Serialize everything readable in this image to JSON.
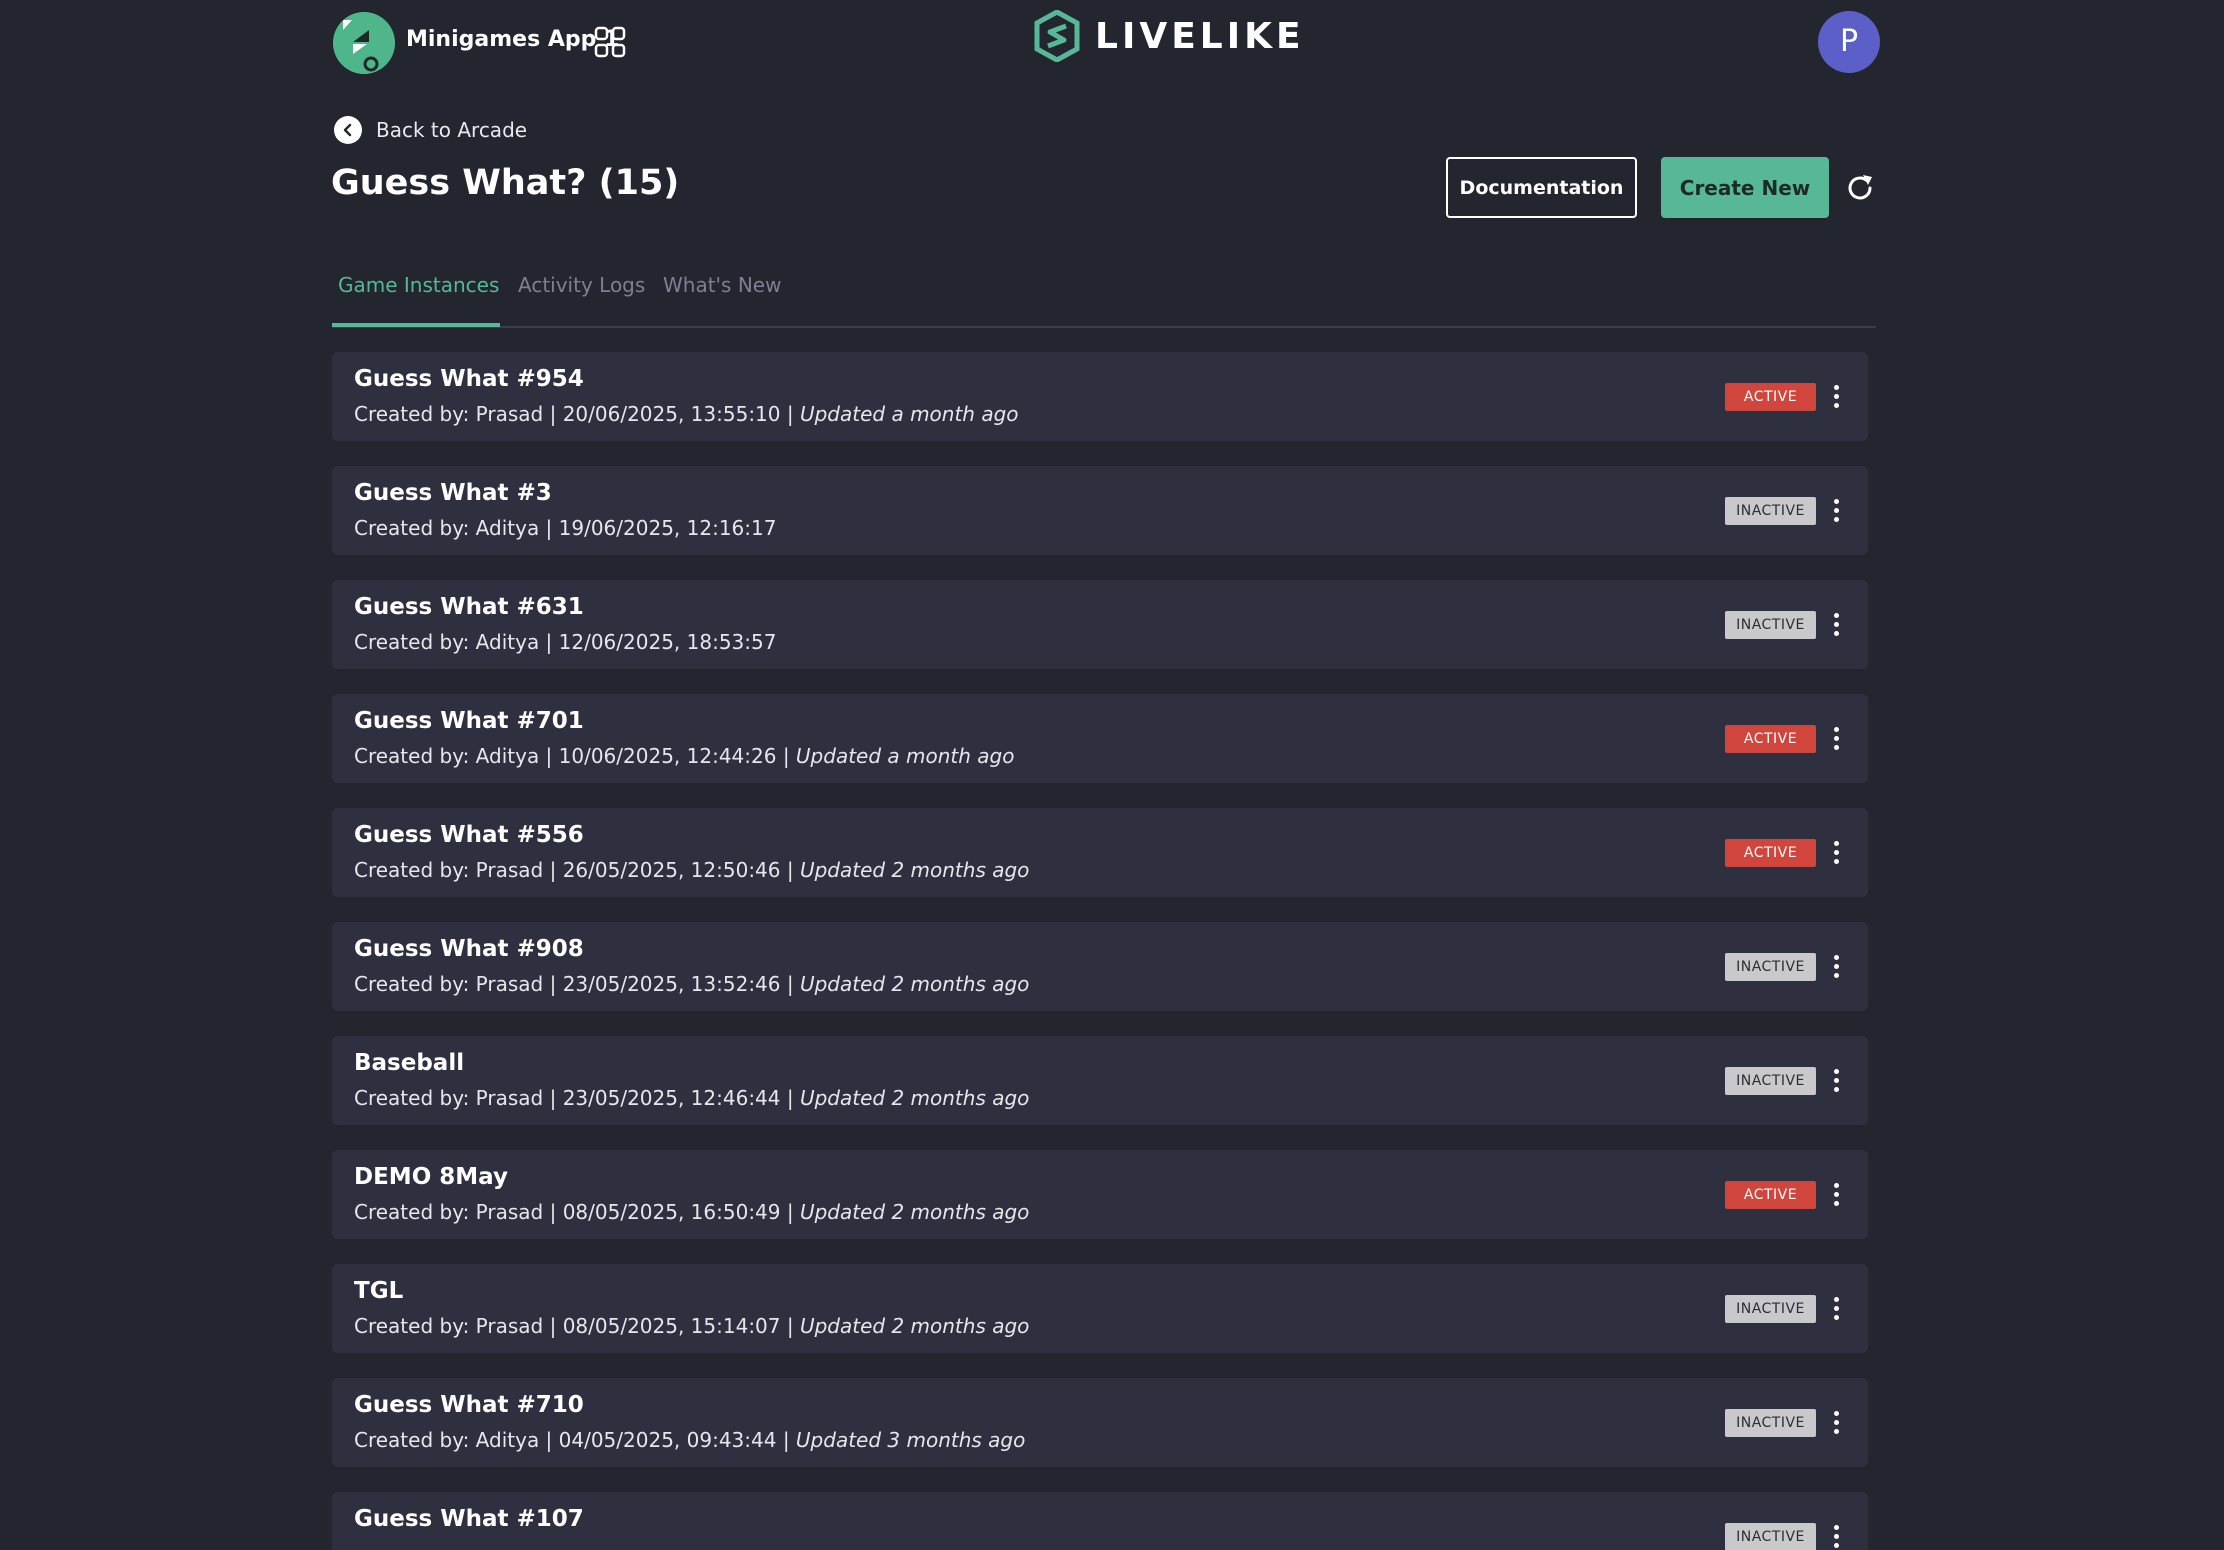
{
  "header": {
    "app_name": "Minigames App 1",
    "brand": "LIVELIKE",
    "avatar_initial": "P"
  },
  "nav": {
    "back_label": "Back to Arcade"
  },
  "page": {
    "title": "Guess What? (15)",
    "documentation_label": "Documentation",
    "create_label": "Create New"
  },
  "tabs": [
    {
      "label": "Game Instances",
      "active": true
    },
    {
      "label": "Activity Logs",
      "active": false
    },
    {
      "label": "What's New",
      "active": false
    }
  ],
  "colors": {
    "accent": "#56b896",
    "background": "#23252f",
    "card": "#2e3040",
    "active_badge": "#d0463d",
    "inactive_badge": "#c9c9cc"
  },
  "instances": [
    {
      "title": "Guess What #954",
      "meta": "Created by: Prasad | 20/06/2025, 13:55:10 | ",
      "updated": "Updated a month ago",
      "status": "ACTIVE"
    },
    {
      "title": "Guess What #3",
      "meta": "Created by: Aditya | 19/06/2025, 12:16:17",
      "updated": "",
      "status": "INACTIVE"
    },
    {
      "title": "Guess What #631",
      "meta": "Created by: Aditya | 12/06/2025, 18:53:57",
      "updated": "",
      "status": "INACTIVE"
    },
    {
      "title": "Guess What #701",
      "meta": "Created by: Aditya | 10/06/2025, 12:44:26 | ",
      "updated": "Updated a month ago",
      "status": "ACTIVE"
    },
    {
      "title": "Guess What #556",
      "meta": "Created by: Prasad | 26/05/2025, 12:50:46 | ",
      "updated": "Updated 2 months ago",
      "status": "ACTIVE"
    },
    {
      "title": "Guess What #908",
      "meta": "Created by: Prasad | 23/05/2025, 13:52:46 | ",
      "updated": "Updated 2 months ago",
      "status": "INACTIVE"
    },
    {
      "title": "Baseball",
      "meta": "Created by: Prasad | 23/05/2025, 12:46:44 | ",
      "updated": "Updated 2 months ago",
      "status": "INACTIVE"
    },
    {
      "title": "DEMO 8May",
      "meta": "Created by: Prasad | 08/05/2025, 16:50:49 | ",
      "updated": "Updated 2 months ago",
      "status": "ACTIVE"
    },
    {
      "title": "TGL",
      "meta": "Created by: Prasad | 08/05/2025, 15:14:07 | ",
      "updated": "Updated 2 months ago",
      "status": "INACTIVE"
    },
    {
      "title": "Guess What #710",
      "meta": "Created by: Aditya | 04/05/2025, 09:43:44 | ",
      "updated": "Updated 3 months ago",
      "status": "INACTIVE"
    },
    {
      "title": "Guess What #107",
      "meta": "",
      "updated": "",
      "status": "INACTIVE"
    }
  ]
}
